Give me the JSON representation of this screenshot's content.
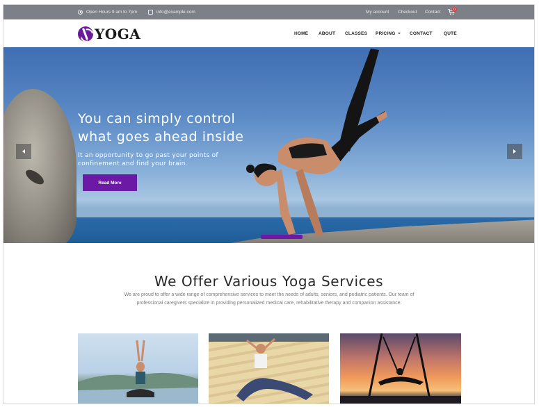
{
  "topbar": {
    "hours": "Open Hours 9 am to 7pm",
    "email": "info@example.com",
    "links": [
      "My account",
      "Checkout",
      "Contact"
    ],
    "cart_count": "0"
  },
  "header": {
    "logo_text": "YOGA",
    "nav": [
      "HOME",
      "ABOUT",
      "CLASSES",
      "PRICING",
      "CONTACT",
      "QUTE"
    ]
  },
  "hero": {
    "title_line1": "You can simply control",
    "title_line2": "what goes ahead inside",
    "subtitle_line1": "It an opportunity to go past your points of",
    "subtitle_line2": "confinement and find your brain.",
    "button": "Read More"
  },
  "services": {
    "title": "We Offer Various Yoga Services",
    "desc_line1": "We are proud to offer a wide range of comprehensive services to meet the needs of adults, seniors, and pediatric patients. Our team of",
    "desc_line2": "professional caregivers specialize in providing personalized medical care, rehabilitative therapy and companion assistance."
  },
  "colors": {
    "accent": "#6c1aa5",
    "topbar": "#7d8187",
    "cart_badge": "#e23b3b"
  },
  "icons": [
    "clock-icon",
    "mail-icon",
    "cart-icon",
    "chevron-left-icon",
    "chevron-right-icon",
    "yoga-logo-icon"
  ]
}
